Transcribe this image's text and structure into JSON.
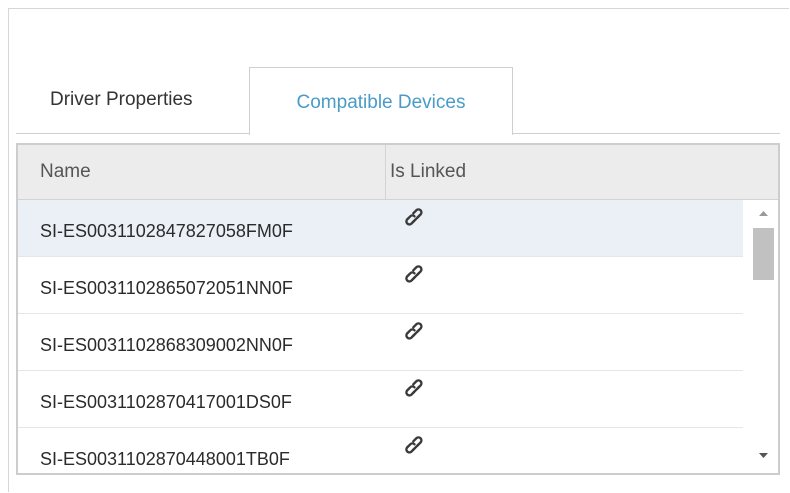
{
  "tabs": {
    "driver_properties": "Driver Properties",
    "compatible_devices": "Compatible Devices",
    "active": "compatible_devices"
  },
  "grid": {
    "columns": [
      "Name",
      "Is Linked"
    ],
    "rows": [
      {
        "name": "SI-ES0031102847827058FM0F",
        "is_linked": "link-icon",
        "selected": true
      },
      {
        "name": "SI-ES0031102865072051NN0F",
        "is_linked": "link-icon",
        "selected": false
      },
      {
        "name": "SI-ES0031102868309002NN0F",
        "is_linked": "link-icon",
        "selected": false
      },
      {
        "name": "SI-ES0031102870417001DS0F",
        "is_linked": "link-icon",
        "selected": false
      },
      {
        "name": "SI-ES0031102870448001TB0F",
        "is_linked": "link-icon",
        "selected": false
      }
    ]
  },
  "colors": {
    "active_tab_text": "#4a9bc7",
    "selected_row": "#eaf0f6",
    "header_background": "#ececec"
  }
}
